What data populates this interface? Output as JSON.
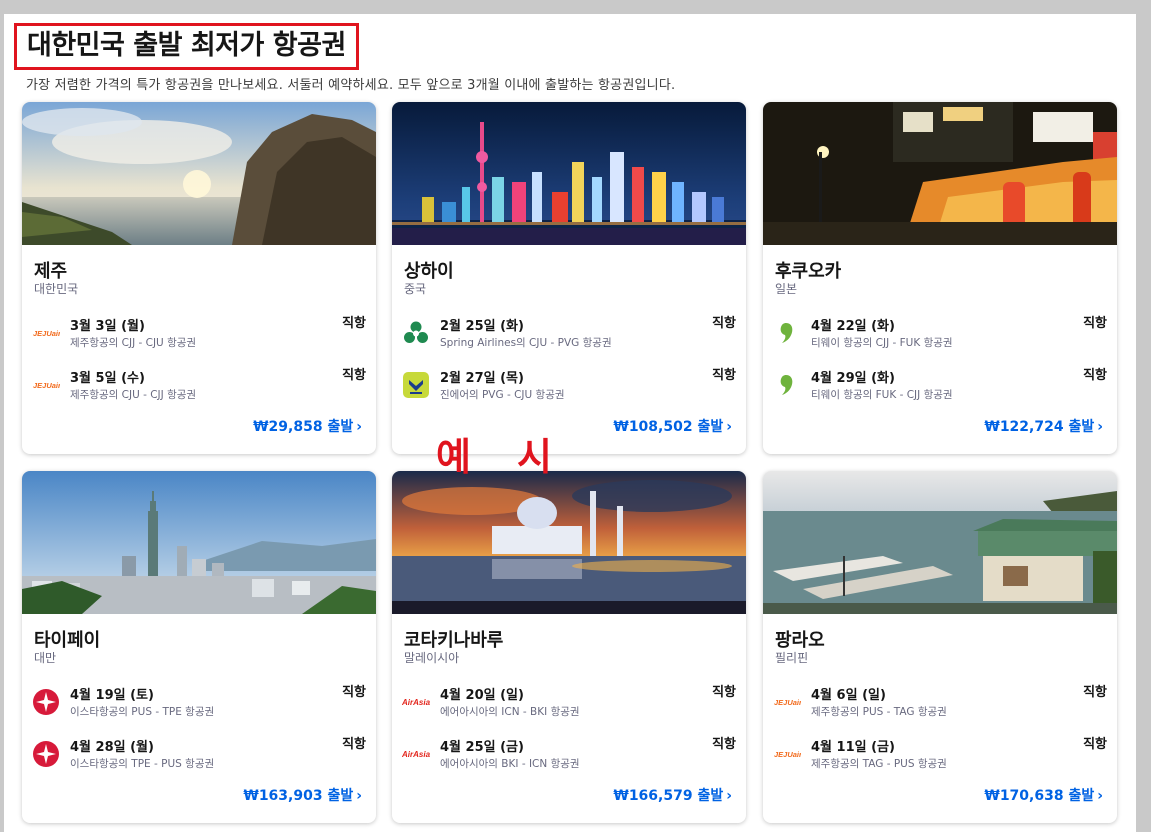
{
  "header": {
    "title": "대한민국 출발 최저가 항공권",
    "subtitle": "가장 저렴한 가격의 특가 항공권을 만나보세요. 서둘러 예약하세요. 모두 앞으로 3개월 이내에 출발하는 항공권입니다."
  },
  "annotation": {
    "left": "예",
    "right": "시"
  },
  "cards": [
    {
      "city": "제주",
      "country": "대한민국",
      "price": "₩29,858 출발",
      "flights": [
        {
          "date": "3월 3일 (월)",
          "route": "제주항공의 CJJ - CJU 항공권",
          "type": "직항",
          "logo": "jejuair-logo-icon"
        },
        {
          "date": "3월 5일 (수)",
          "route": "제주항공의 CJU - CJJ 항공권",
          "type": "직항",
          "logo": "jejuair-logo-icon"
        }
      ]
    },
    {
      "city": "상하이",
      "country": "중국",
      "price": "₩108,502 출발",
      "flights": [
        {
          "date": "2월 25일 (화)",
          "route": "Spring Airlines의 CJU - PVG 항공권",
          "type": "직항",
          "logo": "spring-airlines-logo-icon"
        },
        {
          "date": "2월 27일 (목)",
          "route": "진에어의 PVG - CJU 항공권",
          "type": "직항",
          "logo": "jinair-logo-icon"
        }
      ]
    },
    {
      "city": "후쿠오카",
      "country": "일본",
      "price": "₩122,724 출발",
      "flights": [
        {
          "date": "4월 22일 (화)",
          "route": "티웨이 항공의 CJJ - FUK 항공권",
          "type": "직항",
          "logo": "tway-logo-icon"
        },
        {
          "date": "4월 29일 (화)",
          "route": "티웨이 항공의 FUK - CJJ 항공권",
          "type": "직항",
          "logo": "tway-logo-icon"
        }
      ]
    },
    {
      "city": "타이페이",
      "country": "대만",
      "price": "₩163,903 출발",
      "flights": [
        {
          "date": "4월 19일 (토)",
          "route": "이스타항공의 PUS - TPE 항공권",
          "type": "직항",
          "logo": "eastarjet-logo-icon"
        },
        {
          "date": "4월 28일 (월)",
          "route": "이스타항공의 TPE - PUS 항공권",
          "type": "직항",
          "logo": "eastarjet-logo-icon"
        }
      ]
    },
    {
      "city": "코타키나바루",
      "country": "말레이시아",
      "price": "₩166,579 출발",
      "flights": [
        {
          "date": "4월 20일 (일)",
          "route": "에어아시아의 ICN - BKI 항공권",
          "type": "직항",
          "logo": "airasia-logo-icon"
        },
        {
          "date": "4월 25일 (금)",
          "route": "에어아시아의 BKI - ICN 항공권",
          "type": "직항",
          "logo": "airasia-logo-icon"
        }
      ]
    },
    {
      "city": "팡라오",
      "country": "필리핀",
      "price": "₩170,638 출발",
      "flights": [
        {
          "date": "4월 6일 (일)",
          "route": "제주항공의 PUS - TAG 항공권",
          "type": "직항",
          "logo": "jejuair-logo-icon"
        },
        {
          "date": "4월 11일 (금)",
          "route": "제주항공의 TAG - PUS 항공권",
          "type": "직항",
          "logo": "jejuair-logo-icon"
        }
      ]
    }
  ],
  "logo_text": {
    "jejuair": "JEJUair",
    "airasia": "AirAsia"
  },
  "colors": {
    "title_box": "#e0141e",
    "price": "#0062e3",
    "jejuair": "#f26b1d",
    "tway": "#6fb33d",
    "spring": "#2e8b57",
    "eastar": "#d71a3a",
    "airasia": "#e2231a"
  }
}
